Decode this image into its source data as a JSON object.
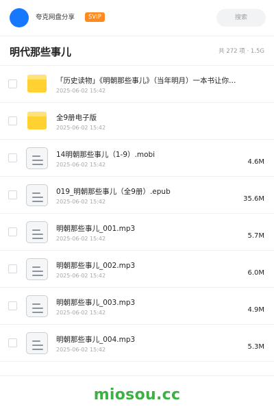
{
  "header": {
    "owner_name": "夸克网盘分享",
    "badge": "SVIP",
    "search_placeholder": "搜索"
  },
  "folder": {
    "title": "明代那些事儿",
    "meta": "共 272 项 · 1.5G"
  },
  "files": [
    {
      "type": "folder",
      "name": "「历史读物」《明朝那些事儿》（当年明月）一本书让你…",
      "date": "2025-06-02 15:42",
      "size": ""
    },
    {
      "type": "folder",
      "name": "全9册电子版",
      "date": "2025-06-02 15:42",
      "size": ""
    },
    {
      "type": "file",
      "name": "14明朝那些事儿（1-9）.mobi",
      "date": "2025-06-02 15:42",
      "size": "4.6M"
    },
    {
      "type": "file",
      "name": "019_明朝那些事儿（全9册）.epub",
      "date": "2025-06-02 15:42",
      "size": "35.6M"
    },
    {
      "type": "file",
      "name": "明朝那些事儿_001.mp3",
      "date": "2025-06-02 15:42",
      "size": "5.7M"
    },
    {
      "type": "file",
      "name": "明朝那些事儿_002.mp3",
      "date": "2025-06-02 15:42",
      "size": "6.0M"
    },
    {
      "type": "file",
      "name": "明朝那些事儿_003.mp3",
      "date": "2025-06-02 15:42",
      "size": "4.9M"
    },
    {
      "type": "file",
      "name": "明朝那些事儿_004.mp3",
      "date": "2025-06-02 15:42",
      "size": "5.3M"
    }
  ],
  "footer": {
    "watermark": "miosou.cc"
  },
  "colors": {
    "accent": "#1677ff",
    "svip": "#ff8a1f",
    "folder": "#ffc53d",
    "watermark": "#3cb043"
  }
}
